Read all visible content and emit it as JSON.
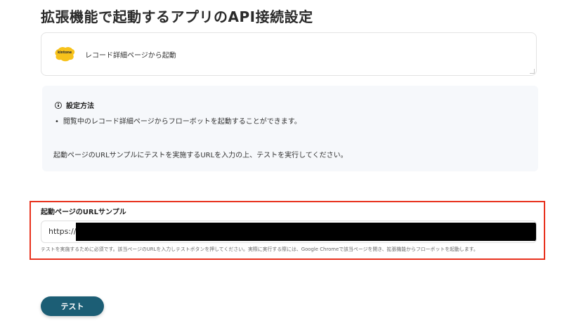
{
  "page": {
    "title": "拡張機能で起動するアプリのAPI接続設定"
  },
  "app_card": {
    "logo_text": "kintone",
    "logo_color": "#F7C21B",
    "label": "レコード詳細ページから起動"
  },
  "info_panel": {
    "title": "設定方法",
    "bullet": "閲覧中のレコード詳細ページからフローボットを起動することができます。",
    "note": "起動ページのURLサンプルにテストを実施するURLを入力の上、テストを実行してください。"
  },
  "url_field": {
    "label": "起動ページのURLサンプル",
    "prefix": "https://",
    "help_text": "テストを実施するために必須です。該当ページのURLを入力しテストボタンを押してください。実際に実行する際には、Google Chromeで該当ページを開き、拡張機能からフローボットを起動します。"
  },
  "actions": {
    "test_label": "テスト"
  },
  "colors": {
    "accent": "#1C5E75",
    "highlight": "#E8311D",
    "panel_bg": "#F6F8FB"
  }
}
